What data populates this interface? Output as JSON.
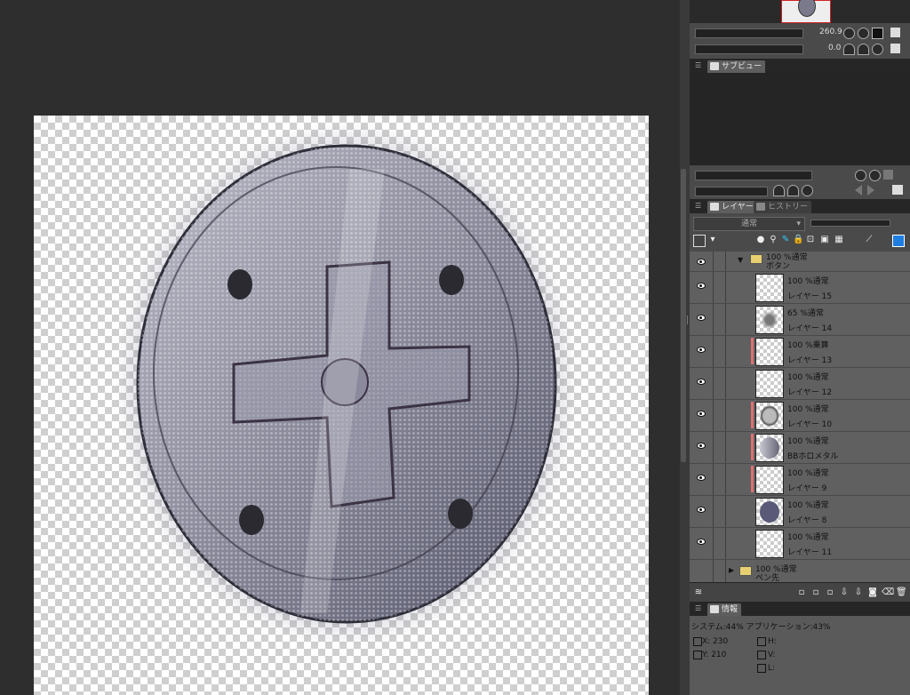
{
  "navigator": {
    "zoom_value": "260.9",
    "angle_value": "0.0"
  },
  "subview_panel": {
    "tab_label": "サブビュー"
  },
  "layer_panel": {
    "tabs": [
      {
        "label": "レイヤー"
      },
      {
        "label": "ヒストリー"
      }
    ],
    "blend_mode": "通常",
    "folder_open": {
      "line1": "100 %通常",
      "line2": "ボタン"
    },
    "layers": [
      {
        "line1": "100 %通常",
        "line2": "レイヤー 15",
        "marked": false,
        "thumb": "empty"
      },
      {
        "line1": "65 %通常",
        "line2": "レイヤー 14",
        "marked": false,
        "thumb": "dots"
      },
      {
        "line1": "100 %乗算",
        "line2": "レイヤー 13",
        "marked": true,
        "thumb": "empty"
      },
      {
        "line1": "100 %通常",
        "line2": "レイヤー 12",
        "marked": false,
        "thumb": "speck"
      },
      {
        "line1": "100 %通常",
        "line2": "レイヤー 10",
        "marked": true,
        "thumb": "ring"
      },
      {
        "line1": "100 %通常",
        "line2": "BBホロメタル",
        "marked": true,
        "thumb": "metal"
      },
      {
        "line1": "100 %通常",
        "line2": "レイヤー 9",
        "marked": true,
        "thumb": "empty"
      },
      {
        "line1": "100 %通常",
        "line2": "レイヤー 8",
        "marked": false,
        "thumb": "disc"
      },
      {
        "line1": "100 %通常",
        "line2": "レイヤー 11",
        "marked": false,
        "thumb": "empty"
      }
    ],
    "folder_closed": {
      "line1": "100 %通常",
      "line2": "ペン先"
    }
  },
  "info_panel": {
    "tab_label": "情報",
    "memory": "システム:44%  アプリケーション:43%",
    "x_label": "X: 230",
    "y_label": "Y: 210",
    "h_label": "H:",
    "v_label": "V:",
    "l_label": "L:"
  },
  "colors": {
    "mark": "#e07070",
    "workspace": "#2e2e2e",
    "panel": "#606060"
  }
}
